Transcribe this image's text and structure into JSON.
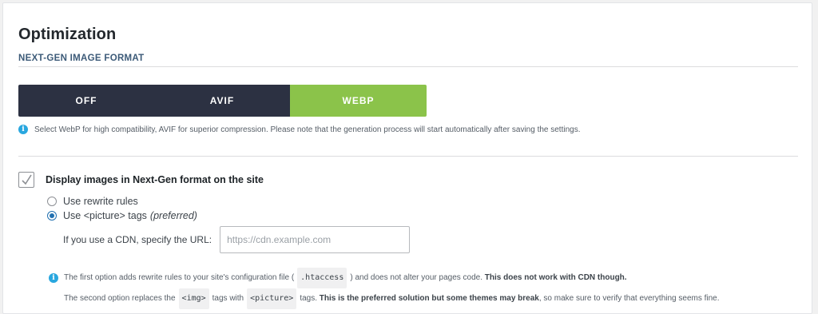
{
  "section": {
    "title": "Optimization",
    "subtitle": "NEXT-GEN IMAGE FORMAT"
  },
  "format_toggle": {
    "options": [
      "OFF",
      "AVIF",
      "WEBP"
    ],
    "selected": "WEBP",
    "active_color": "#8bc34a",
    "inactive_color": "#2c3142"
  },
  "format_info": {
    "icon": "info-icon",
    "text": "Select WebP for high compatibility, AVIF for superior compression. Please note that the generation process will start automatically after saving the settings."
  },
  "display_nextgen": {
    "checked": true,
    "label": "Display images in Next-Gen format on the site",
    "radio_options": [
      {
        "label": "Use rewrite rules",
        "checked": false
      },
      {
        "label": "Use <picture> tags",
        "suffix": "(preferred)",
        "checked": true
      }
    ],
    "cdn": {
      "label": "If you use a CDN, specify the URL:",
      "value": "",
      "placeholder": "https://cdn.example.com"
    }
  },
  "notes": {
    "icon": "info-icon",
    "line1_a": "The first option adds rewrite rules to your site's configuration file (",
    "line1_code": ".htaccess",
    "line1_b": ") and does not alter your pages code.",
    "line1_bold": "This does not work with CDN though.",
    "line2_a": "The second option replaces the",
    "line2_code1": "<img>",
    "line2_b": "tags with",
    "line2_code2": "<picture>",
    "line2_c": "tags.",
    "line2_bold": "This is the preferred solution but some themes may break",
    "line2_d": ", so make sure to verify that everything seems fine."
  },
  "colors": {
    "accent_blue": "#2271b1",
    "info_blue": "#29a7df"
  }
}
